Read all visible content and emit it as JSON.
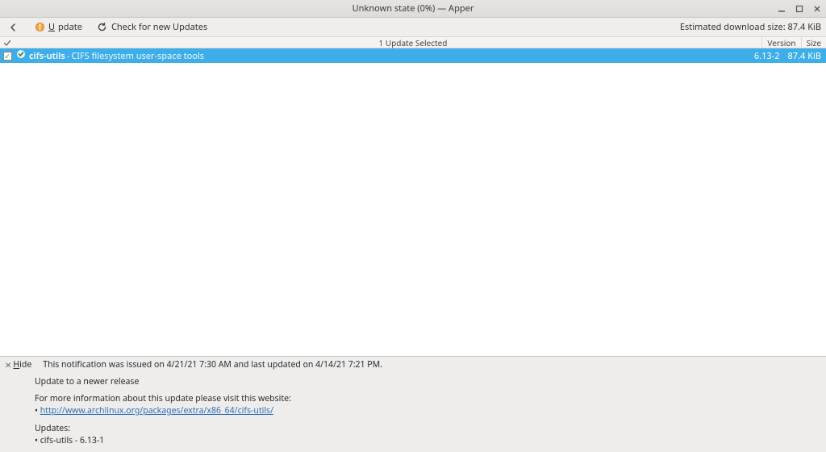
{
  "window": {
    "title": "Unknown state (0%) — Apper"
  },
  "toolbar": {
    "back_tooltip": "Back",
    "update_label": "Update",
    "check_updates_label": "Check for new Updates",
    "download_size_label": "Estimated download size: 87.4 KiB"
  },
  "columns": {
    "selected_label": "1 Update Selected",
    "version_label": "Version",
    "size_label": "Size"
  },
  "packages": [
    {
      "checked": true,
      "name": "cifs-utils",
      "separator": " - ",
      "description": "CIFS filesystem user-space tools",
      "version": "6.13-2",
      "size": "87.4 KiB"
    }
  ],
  "notification": {
    "hide_label": "Hide",
    "issued": "This notification was issued on 4/21/21 7:30 AM and last updated on 4/14/21 7:21 PM.",
    "headline": "Update to a newer release",
    "more_info": "For more information about this update please visit this website:",
    "link_text": "http://www.archlinux.org/packages/extra/x86_64/cifs-utils/",
    "updates_label": "Updates:",
    "update_item": "cifs-utils - 6.13-1",
    "bullet": "• "
  }
}
